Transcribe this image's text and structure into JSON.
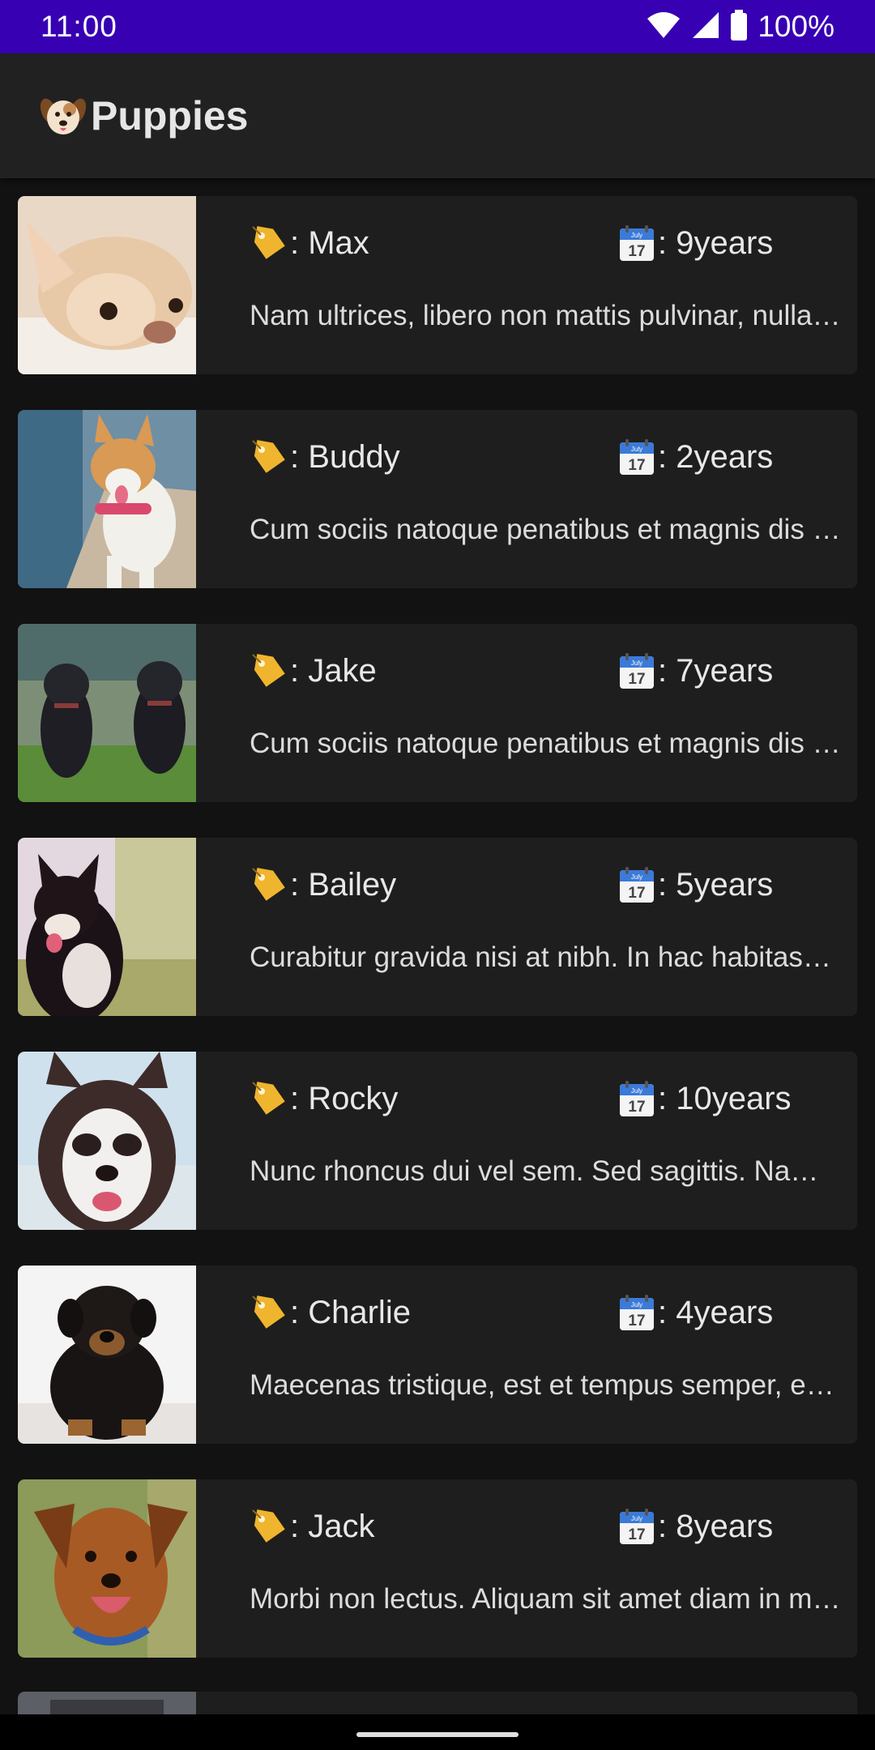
{
  "status": {
    "time": "11:00",
    "battery": "100%"
  },
  "app": {
    "title": "Puppies",
    "title_icon": "dog-face-icon"
  },
  "icons": {
    "name": "label-tag-icon",
    "age": "calendar-icon"
  },
  "calendar_label": "July",
  "calendar_day": "17",
  "puppies": [
    {
      "name": ": Max",
      "age": ": 9years",
      "desc": "Nam ultrices, libero non mattis pulvinar, nulla pede ullamcorper augue"
    },
    {
      "name": ": Buddy",
      "age": ": 2years",
      "desc": "Cum sociis natoque penatibus et magnis dis parturient montes"
    },
    {
      "name": ": Jake",
      "age": ": 7years",
      "desc": "Cum sociis natoque penatibus et magnis dis parturient montes"
    },
    {
      "name": ": Bailey",
      "age": ": 5years",
      "desc": "Curabitur gravida nisi at nibh. In hac habitasse platea dictumst"
    },
    {
      "name": ": Rocky",
      "age": ": 10years",
      "desc": "Nunc rhoncus dui vel sem. Sed sagittis. Nam congue"
    },
    {
      "name": ": Charlie",
      "age": ": 4years",
      "desc": "Maecenas tristique, est et tempus semper, est quam pharetra"
    },
    {
      "name": ": Jack",
      "age": ": 8years",
      "desc": "Morbi non lectus. Aliquam sit amet diam in magna bibendum"
    }
  ]
}
